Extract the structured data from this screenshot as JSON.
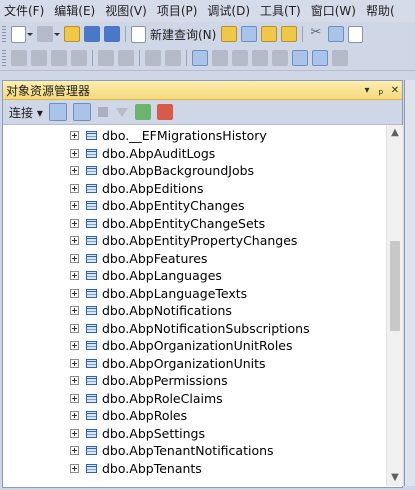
{
  "menu": [
    "文件(F)",
    "编辑(E)",
    "视图(V)",
    "项目(P)",
    "调试(D)",
    "工具(T)",
    "窗口(W)",
    "帮助("
  ],
  "toolbar": {
    "new_query_label": "新建查询(N)"
  },
  "panel": {
    "title": "对象资源管理器",
    "pin": "ₚ",
    "close": "✕",
    "dropdown": "▾",
    "connect_label": "连接 ▾"
  },
  "tree": {
    "items": [
      "dbo.__EFMigrationsHistory",
      "dbo.AbpAuditLogs",
      "dbo.AbpBackgroundJobs",
      "dbo.AbpEditions",
      "dbo.AbpEntityChanges",
      "dbo.AbpEntityChangeSets",
      "dbo.AbpEntityPropertyChanges",
      "dbo.AbpFeatures",
      "dbo.AbpLanguages",
      "dbo.AbpLanguageTexts",
      "dbo.AbpNotifications",
      "dbo.AbpNotificationSubscriptions",
      "dbo.AbpOrganizationUnitRoles",
      "dbo.AbpOrganizationUnits",
      "dbo.AbpPermissions",
      "dbo.AbpRoleClaims",
      "dbo.AbpRoles",
      "dbo.AbpSettings",
      "dbo.AbpTenantNotifications",
      "dbo.AbpTenants"
    ]
  },
  "scrollbar": {
    "up": "▲",
    "down": "▼",
    "position_fraction": 0.42
  }
}
